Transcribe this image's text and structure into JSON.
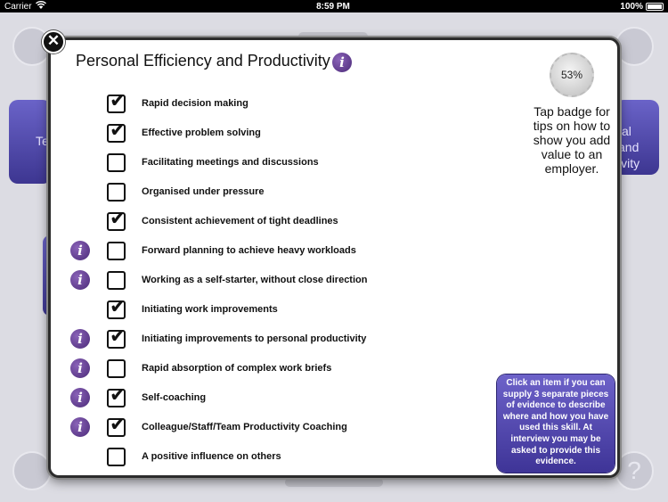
{
  "status_bar": {
    "carrier": "Carrier",
    "time": "8:59 PM",
    "battery": "100%"
  },
  "background": {
    "tile_left_text": "Te",
    "tile_right_lines": [
      "al",
      "and",
      "ivity"
    ],
    "help_glyph": "?"
  },
  "dialog": {
    "close_glyph": "✕",
    "title": "Personal Efficiency and Productivity",
    "info_glyph": "i",
    "badge_percent": "53%",
    "badge_tip": "Tap badge for tips on how to show you add value to an employer.",
    "hint": "Click an item if you can supply 3 separate pieces of evidence to describe where and how you have used this skill. At interview you may be asked to provide this evidence."
  },
  "skills": [
    {
      "label": "Rapid decision making",
      "checked": true,
      "info": false
    },
    {
      "label": "Effective problem solving",
      "checked": true,
      "info": false
    },
    {
      "label": "Facilitating meetings and discussions",
      "checked": false,
      "info": false
    },
    {
      "label": "Organised under pressure",
      "checked": false,
      "info": false
    },
    {
      "label": "Consistent achievement of tight deadlines",
      "checked": true,
      "info": false
    },
    {
      "label": "Forward planning to achieve heavy workloads",
      "checked": false,
      "info": true
    },
    {
      "label": "Working as a self-starter, without close direction",
      "checked": false,
      "info": true
    },
    {
      "label": "Initiating work improvements",
      "checked": true,
      "info": false
    },
    {
      "label": "Initiating improvements to personal productivity",
      "checked": true,
      "info": true
    },
    {
      "label": "Rapid absorption of complex work briefs",
      "checked": false,
      "info": true
    },
    {
      "label": "Self-coaching",
      "checked": true,
      "info": true
    },
    {
      "label": "Colleague/Staff/Team Productivity Coaching",
      "checked": true,
      "info": true
    },
    {
      "label": "A positive influence on others",
      "checked": false,
      "info": false
    }
  ],
  "colors": {
    "accent": "#4b3fa6",
    "info": "#5b3a8c"
  }
}
